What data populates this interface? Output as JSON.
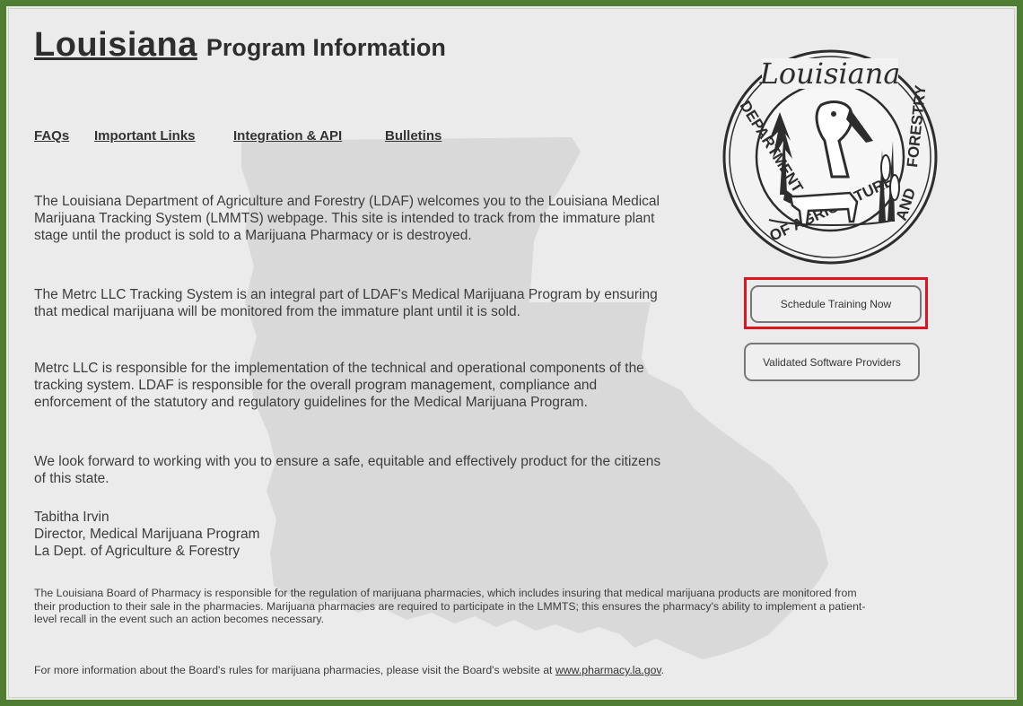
{
  "header": {
    "title_main": "Louisiana",
    "title_sub": "Program Information"
  },
  "nav": {
    "faqs": "FAQs",
    "important_links": "Important Links",
    "integration_api": "Integration & API",
    "bulletins": "Bulletins"
  },
  "content": {
    "p1": "The Louisiana Department of Agriculture and Forestry (LDAF) welcomes you to the Louisiana Medical Marijuana Tracking System (LMMTS) webpage. This site is intended to track from the immature plant stage until the product is sold to a Marijuana Pharmacy or is destroyed.",
    "p2": "The Metrc LLC Tracking System is an integral part of LDAF's Medical Marijuana Program by ensuring that medical marijuana will be monitored from the immature plant until it is sold.",
    "p3": "Metrc LLC is responsible for the implementation of the technical and operational components of the tracking system. LDAF is responsible for the overall program management, compliance and enforcement of the statutory and regulatory guidelines for the Medical Marijuana Program.",
    "p4": "We look forward to working with you to ensure a safe, equitable and effectively product for the citizens of this state.",
    "signature": {
      "name": "Tabitha Irvin",
      "title": "Director, Medical Marijuana Program",
      "org": "La Dept. of Agriculture & Forestry"
    },
    "board_note": "The Louisiana Board of Pharmacy is responsible for the regulation of marijuana pharmacies, which includes insuring that medical marijuana products are monitored from their production to their sale in the pharmacies.  Marijuana pharmacies are required to participate in the LMMTS; this ensures the pharmacy's ability to implement a patient-level recall in the event such an action becomes necessary.",
    "more_info_prefix": "For more information about the Board's rules for marijuana pharmacies, please visit the Board's website at ",
    "more_info_link": "www.pharmacy.la.gov",
    "more_info_suffix": "."
  },
  "seal": {
    "script": "Louisiana",
    "ring_text": "DEPARTMENT OF AGRICULTURE AND FORESTRY",
    "icon": "ldaf-seal-icon"
  },
  "buttons": {
    "schedule_training": "Schedule Training Now",
    "validated_providers": "Validated Software Providers"
  },
  "colors": {
    "frame_border": "#4f7d32",
    "background": "#ebebeb",
    "map_silhouette": "#d9d9d9",
    "highlight": "#e0141e",
    "text": "#3d3d3d"
  }
}
